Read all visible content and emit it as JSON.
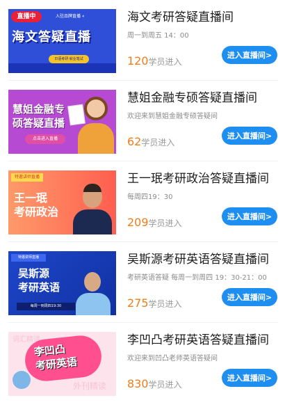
{
  "items": [
    {
      "title": "海文考研答疑直播间",
      "subtitle": "周一到周五 14：00",
      "count": "120",
      "count_suffix": "学员进入",
      "button": "进入直播间>",
      "thumb": {
        "live": "直播中",
        "note": "入驻品牌直播 «",
        "big": "海文答疑直播",
        "pill": "日语考研·就业笔试"
      }
    },
    {
      "title": "慧姐金融专硕答疑直播间",
      "subtitle": "欢迎来到慧姐金融专硕答疑间",
      "count": "62",
      "count_suffix": "学员进入",
      "button": "进入直播间>",
      "thumb": {
        "big_line1": "慧姐金融专",
        "big_line2": "硕答疑直播",
        "pill": "点击进入直播"
      }
    },
    {
      "title": "王一珉考研政治答疑直播间",
      "subtitle": "每周四19：30",
      "count": "209",
      "count_suffix": "学员进入",
      "button": "进入直播间>",
      "thumb": {
        "tag": "特邀讲师直播",
        "big_line1": "王一珉",
        "big_line2": "考研政治"
      }
    },
    {
      "title": "吴斯源考研英语答疑直播间",
      "subtitle": "考研英语答疑 每周一到周四 19：30-21：00",
      "count": "275",
      "count_suffix": "学员进入",
      "button": "进入直播间>",
      "thumb": {
        "tag": "特邀讲师直播",
        "big_line1": "吴斯源",
        "big_line2": "考研英语",
        "time": "每周一到周四19:30"
      }
    },
    {
      "title": "李凹凸考研英语答疑直播间",
      "subtitle": "欢迎来到凹凸老师英语答疑间",
      "count": "830",
      "count_suffix": "学员进入",
      "button": "进入直播间>",
      "thumb": {
        "word_top": "词汇精讲",
        "big_line1": "李凹凸",
        "big_line2": "考研英语",
        "word_bottom": "外刊精读"
      }
    }
  ],
  "colors": {
    "accent": "#1f8ef1",
    "count": "#f07c1a"
  }
}
